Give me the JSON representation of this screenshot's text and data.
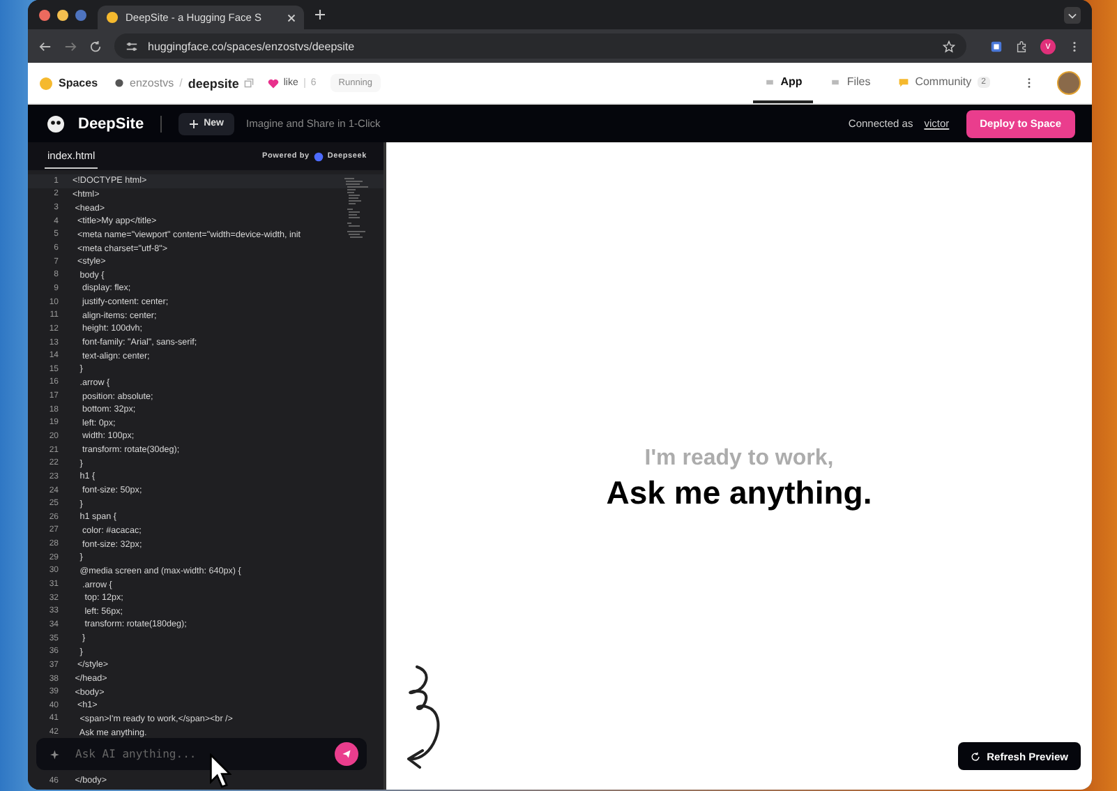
{
  "browser": {
    "tab_title": "DeepSite - a Hugging Face S",
    "url": "huggingface.co/spaces/enzostvs/deepsite",
    "profile_initial": "v"
  },
  "hf_header": {
    "brand": "Spaces",
    "owner": "enzostvs",
    "separator": "/",
    "repo": "deepsite",
    "like_label": "like",
    "like_count": "6",
    "status": "Running",
    "tabs": [
      {
        "label": "App",
        "selected": true
      },
      {
        "label": "Files",
        "selected": false
      },
      {
        "label": "Community",
        "badge": "2",
        "selected": false
      }
    ]
  },
  "app_bar": {
    "logo": "DeepSite",
    "new_button": "New",
    "tagline": "Imagine and Share in 1-Click",
    "connected_prefix": "Connected as",
    "user": "victor",
    "deploy_button": "Deploy to Space"
  },
  "editor": {
    "file_tab": "index.html",
    "powered_by": "Powered by",
    "engine": "Deepseek",
    "lines": [
      {
        "n": "1",
        "text": "<!DOCTYPE html>"
      },
      {
        "n": "2",
        "text": "<html>"
      },
      {
        "n": "3",
        "text": " <head>"
      },
      {
        "n": "4",
        "text": "  <title>My app</title>"
      },
      {
        "n": "5",
        "text": "  <meta name=\"viewport\" content=\"width=device-width, init"
      },
      {
        "n": "6",
        "text": "  <meta charset=\"utf-8\">"
      },
      {
        "n": "7",
        "text": "  <style>"
      },
      {
        "n": "8",
        "text": "   body {"
      },
      {
        "n": "9",
        "text": "    display: flex;"
      },
      {
        "n": "10",
        "text": "    justify-content: center;"
      },
      {
        "n": "11",
        "text": "    align-items: center;"
      },
      {
        "n": "12",
        "text": "    height: 100dvh;"
      },
      {
        "n": "13",
        "text": "    font-family: \"Arial\", sans-serif;"
      },
      {
        "n": "14",
        "text": "    text-align: center;"
      },
      {
        "n": "15",
        "text": "   }"
      },
      {
        "n": "16",
        "text": "   .arrow {"
      },
      {
        "n": "17",
        "text": "    position: absolute;"
      },
      {
        "n": "18",
        "text": "    bottom: 32px;"
      },
      {
        "n": "19",
        "text": "    left: 0px;"
      },
      {
        "n": "20",
        "text": "    width: 100px;"
      },
      {
        "n": "21",
        "text": "    transform: rotate(30deg);"
      },
      {
        "n": "22",
        "text": "   }"
      },
      {
        "n": "23",
        "text": "   h1 {"
      },
      {
        "n": "24",
        "text": "    font-size: 50px;"
      },
      {
        "n": "25",
        "text": "   }"
      },
      {
        "n": "26",
        "text": "   h1 span {"
      },
      {
        "n": "27",
        "text": "    color: #acacac;"
      },
      {
        "n": "28",
        "text": "    font-size: 32px;"
      },
      {
        "n": "29",
        "text": "   }"
      },
      {
        "n": "30",
        "text": "   @media screen and (max-width: 640px) {"
      },
      {
        "n": "31",
        "text": "    .arrow {"
      },
      {
        "n": "32",
        "text": "     top: 12px;"
      },
      {
        "n": "33",
        "text": "     left: 56px;"
      },
      {
        "n": "34",
        "text": "     transform: rotate(180deg);"
      },
      {
        "n": "35",
        "text": "    }"
      },
      {
        "n": "36",
        "text": "   }"
      },
      {
        "n": "37",
        "text": "  </style>"
      },
      {
        "n": "38",
        "text": " </head>"
      },
      {
        "n": "39",
        "text": " <body>"
      },
      {
        "n": "40",
        "text": "  <h1>"
      },
      {
        "n": "41",
        "text": "   <span>I'm ready to work,</span><br />"
      },
      {
        "n": "42",
        "text": "   Ask me anything."
      }
    ],
    "tail_line": {
      "n": "46",
      "text": " </body>"
    },
    "prompt_placeholder": "Ask AI anything..."
  },
  "preview": {
    "subtitle": "I'm ready to work,",
    "title": "Ask me anything.",
    "refresh_button": "Refresh Preview"
  }
}
